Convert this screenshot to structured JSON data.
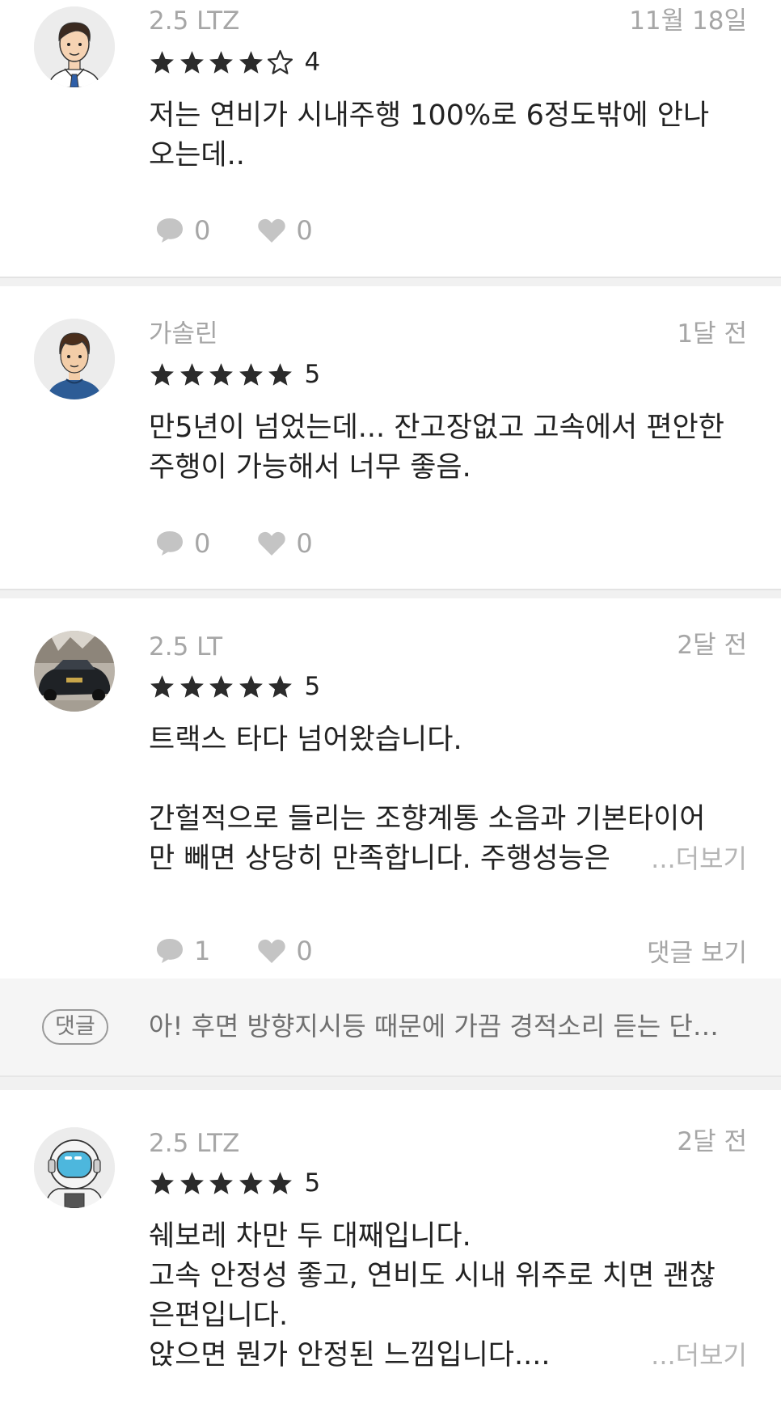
{
  "reviews": [
    {
      "avatar_icon": "businessman-avatar-icon",
      "trim": "2.5 LTZ",
      "date": "11월 18일",
      "rating": 4,
      "rating_text": "4",
      "body": "저는 연비가 시내주행 100%로 6정도밖에 안나\n오는데..",
      "comment_count": "0",
      "like_count": "0"
    },
    {
      "avatar_icon": "man-blue-shirt-avatar-icon",
      "trim": "가솔린",
      "date": "1달 전",
      "rating": 5,
      "rating_text": "5",
      "body": "만5년이 넘었는데... 잔고장없고 고속에서 편안한\n주행이 가능해서 너무 좋음.",
      "comment_count": "0",
      "like_count": "0"
    },
    {
      "avatar_icon": "black-car-photo-avatar",
      "trim": "2.5 LT",
      "date": "2달 전",
      "rating": 5,
      "rating_text": "5",
      "body": "트랙스 타다 넘어왔습니다.\n\n간헐적으로 들리는 조향계통 소음과 기본타이어\n만 빼면 상당히 만족합니다. 주행성능은",
      "more_label": "...더보기",
      "comment_count": "1",
      "like_count": "0",
      "view_comments_label": "댓글 보기",
      "comment_preview": {
        "tag": "댓글",
        "text": "아! 후면 방향지시등 때문에 가끔 경적소리 듣는 단…"
      }
    },
    {
      "avatar_icon": "astronaut-avatar-icon",
      "trim": "2.5 LTZ",
      "date": "2달 전",
      "rating": 5,
      "rating_text": "5",
      "body": "쉐보레 차만 두 대째입니다.\n고속 안정성 좋고, 연비도 시내 위주로 치면 괜찮\n은편입니다.\n앉으면 뭔가 안정된 느낌입니다....",
      "more_label": "...더보기"
    }
  ],
  "colors": {
    "star": "#2b2b2b",
    "meta_gray": "#a6a6a6",
    "separator": "#f1f1f1",
    "comment_bg": "#f5f5f5"
  }
}
